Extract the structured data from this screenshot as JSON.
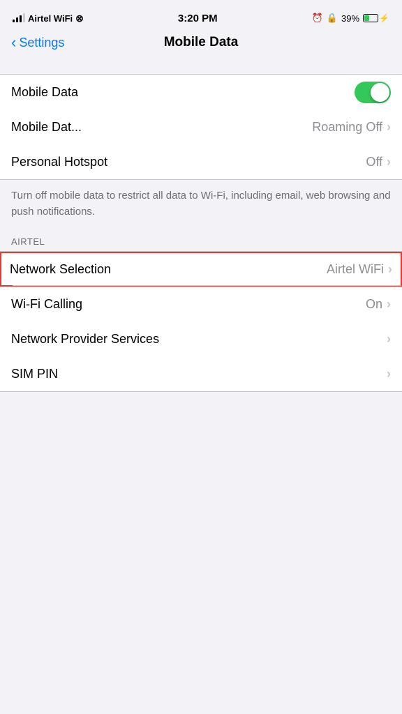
{
  "statusBar": {
    "carrier": "Airtel WiFi",
    "time": "3:20 PM",
    "battery_percent": "39%",
    "wifi": true,
    "charging": true
  },
  "navigation": {
    "back_label": "Settings",
    "title": "Mobile Data"
  },
  "rows": [
    {
      "id": "mobile-data-toggle",
      "label": "Mobile Data",
      "type": "toggle",
      "value": true
    },
    {
      "id": "mobile-data-roaming",
      "label": "Mobile Dat...",
      "type": "value-chevron",
      "value": "Roaming Off"
    },
    {
      "id": "personal-hotspot",
      "label": "Personal Hotspot",
      "type": "value-chevron",
      "value": "Off"
    }
  ],
  "description": "Turn off mobile data to restrict all data to Wi-Fi, including email, web browsing and push notifications.",
  "airtel_section_label": "AIRTEL",
  "airtel_rows": [
    {
      "id": "network-selection",
      "label": "Network Selection",
      "type": "value-chevron",
      "value": "Airtel WiFi",
      "highlighted": true
    },
    {
      "id": "wifi-calling",
      "label": "Wi-Fi Calling",
      "type": "value-chevron",
      "value": "On"
    },
    {
      "id": "network-provider-services",
      "label": "Network Provider Services",
      "type": "chevron-only",
      "value": ""
    },
    {
      "id": "sim-pin",
      "label": "SIM PIN",
      "type": "chevron-only",
      "value": ""
    }
  ]
}
